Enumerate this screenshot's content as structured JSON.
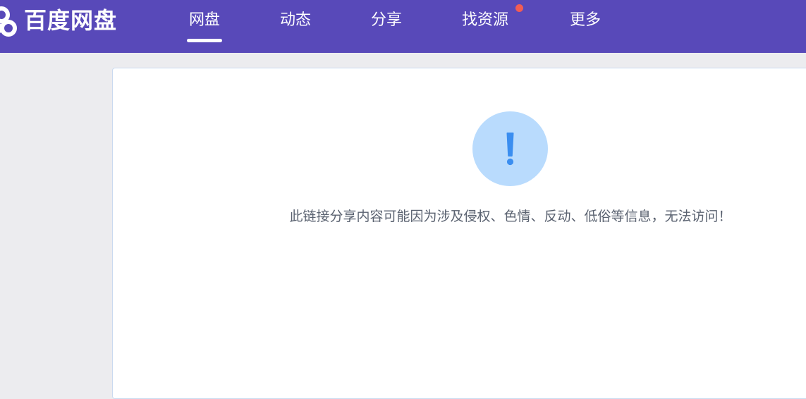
{
  "header": {
    "brand": "百度网盘",
    "nav": [
      {
        "label": "网盘",
        "active": true
      },
      {
        "label": "动态",
        "active": false
      },
      {
        "label": "分享",
        "active": false
      },
      {
        "label": "找资源",
        "active": false,
        "badge_dot": true
      },
      {
        "label": "更多",
        "active": false
      }
    ]
  },
  "notice": {
    "icon": "exclamation-icon",
    "message": "此链接分享内容可能因为涉及侵权、色情、反动、低俗等信息，无法访问！"
  },
  "colors": {
    "header_bg": "#5849b9",
    "page_bg": "#ececef",
    "icon_circle": "#b9dbfd",
    "icon_mark": "#3b8ef0",
    "badge_dot": "#f25c54",
    "message_text": "#5a6270"
  }
}
